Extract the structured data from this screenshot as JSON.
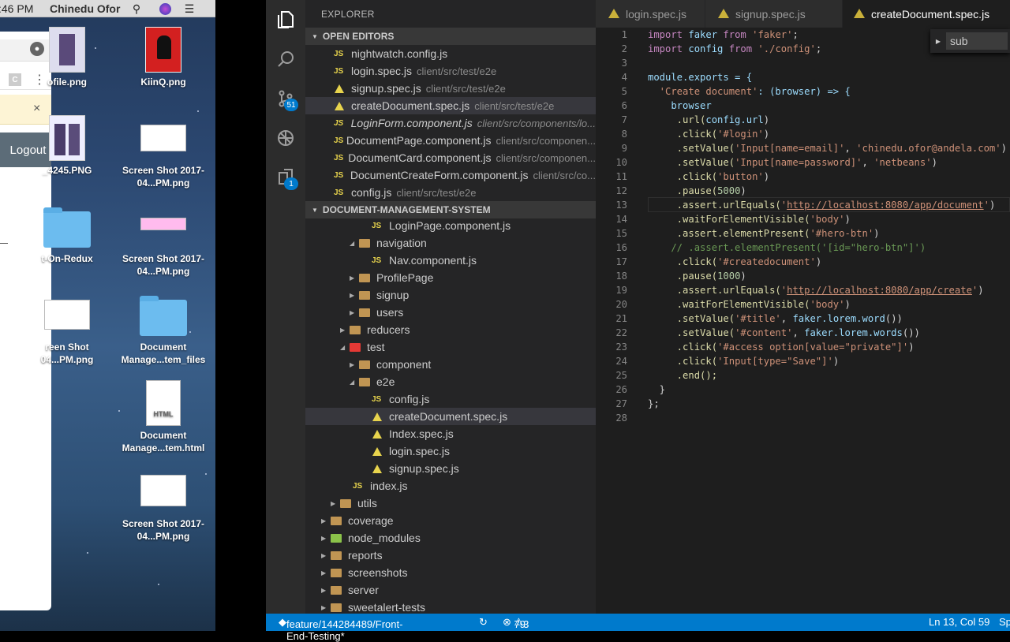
{
  "menubar": {
    "time": ":46 PM",
    "user": "Chinedu Ofor"
  },
  "browser": {
    "ext_letter": "C",
    "logout": "Logout"
  },
  "desktop_icons": [
    {
      "label": "ofile.png"
    },
    {
      "label": "KiinQ.png"
    },
    {
      "label": "_4245.PNG"
    },
    {
      "label": "Screen Shot 2017-04...PM.png"
    },
    {
      "label": "t-On-Redux"
    },
    {
      "label": "Screen Shot 2017-04...PM.png"
    },
    {
      "label": "reen Shot 04...PM.png"
    },
    {
      "label": "Document Manage...tem_files"
    },
    {
      "label": "Document Manage...tem.html"
    },
    {
      "label": "Screen Shot 2017-04...PM.png"
    }
  ],
  "activity": {
    "git_badge": "51",
    "ext_badge": "1"
  },
  "explorer": {
    "title": "EXPLORER",
    "open_editors_label": "OPEN EDITORS",
    "open_editors": [
      {
        "name": "nightwatch.config.js",
        "desc": ""
      },
      {
        "name": "login.spec.js",
        "desc": "client/src/test/e2e"
      },
      {
        "name": "signup.spec.js",
        "desc": "client/src/test/e2e"
      },
      {
        "name": "createDocument.spec.js",
        "desc": "client/src/test/e2e"
      },
      {
        "name": "LoginForm.component.js",
        "desc": "client/src/components/lo..."
      },
      {
        "name": "DocumentPage.component.js",
        "desc": "client/src/componen..."
      },
      {
        "name": "DocumentCard.component.js",
        "desc": "client/src/componen..."
      },
      {
        "name": "DocumentCreateForm.component.js",
        "desc": "client/src/co..."
      },
      {
        "name": "config.js",
        "desc": "client/src/test/e2e"
      }
    ],
    "project_label": "DOCUMENT-MANAGEMENT-SYSTEM",
    "tree": [
      "LoginPage.component.js",
      "navigation",
      "Nav.component.js",
      "ProfilePage",
      "signup",
      "users",
      "reducers",
      "test",
      "component",
      "e2e",
      "config.js",
      "createDocument.spec.js",
      "Index.spec.js",
      "login.spec.js",
      "signup.spec.js",
      "index.js",
      "utils",
      "coverage",
      "node_modules",
      "reports",
      "screenshots",
      "server",
      "sweetalert-tests"
    ]
  },
  "tabs": [
    "login.spec.js",
    "signup.spec.js",
    "createDocument.spec.js"
  ],
  "find": {
    "value": "sub"
  },
  "code_lines": [
    "1",
    "2",
    "3",
    "4",
    "5",
    "6",
    "7",
    "8",
    "9",
    "10",
    "11",
    "12",
    "13",
    "14",
    "15",
    "16",
    "17",
    "18",
    "19",
    "20",
    "21",
    "22",
    "23",
    "24",
    "25",
    "26",
    "27",
    "28"
  ],
  "code": {
    "l1a": "import",
    "l1b": " faker ",
    "l1c": "from",
    "l1d": " 'faker'",
    "l1e": ";",
    "l2a": "import",
    "l2b": " config ",
    "l2c": "from",
    "l2d": " './config'",
    "l2e": ";",
    "l4": "module.exports = {",
    "l5a": "  'Create document'",
    "l5b": ": (browser) => {",
    "l6": "    browser",
    "l7a": "     .url(",
    "l7b": "config.url",
    "l7c": ")",
    "l8a": "     .click(",
    "l8b": "'#login'",
    "l8c": ")",
    "l9a": "     .setValue(",
    "l9b": "'Input[name=email]'",
    "l9c": ", ",
    "l9d": "'chinedu.ofor@andela.com'",
    "l9e": ")",
    "l10a": "     .setValue(",
    "l10b": "'Input[name=password]'",
    "l10c": ", ",
    "l10d": "'netbeans'",
    "l10e": ")",
    "l11a": "     .click(",
    "l11b": "'button'",
    "l11c": ")",
    "l12a": "     .pause(",
    "l12b": "5000",
    "l12c": ")",
    "l13a": "     .assert.urlEquals(",
    "l13b": "'",
    "l13c": "http://localhost:8080/app/document",
    "l13d": "'",
    ")": ")",
    "l14a": "     .waitForElementVisible(",
    "l14b": "'body'",
    "l14c": ")",
    "l15a": "     .assert.elementPresent(",
    "l15b": "'#hero-btn'",
    "l15c": ")",
    "l16": "    // .assert.elementPresent('[id=\"hero-btn\"]')",
    "l17a": "     .click(",
    "l17b": "'#createdocument'",
    "l17c": ")",
    "l18a": "     .pause(",
    "l18b": "1000",
    "l18c": ")",
    "l19a": "     .assert.urlEquals(",
    "l19b": "'",
    "l19c": "http://localhost:8080/app/create",
    "l19d": "'",
    "l20a": "     .waitForElementVisible(",
    "l20b": "'body'",
    "l20c": ")",
    "l21a": "     .setValue(",
    "l21b": "'#title'",
    "l21c": ", ",
    "l21d": "faker.lorem.word",
    "l21e": "())",
    "l22a": "     .setValue(",
    "l22b": "'#content'",
    "l22c": ", ",
    "l22d": "faker.lorem.words",
    "l22e": "())",
    "l23a": "     .click(",
    "l23b": "'#access option[value=\"private\"]'",
    "l23c": ")",
    "l24a": "     .click(",
    "l24b": "'Input[type=\"Save\"]'",
    "l24c": ")",
    "l25": "     .end();",
    "l26": "  }",
    "l27": "};"
  },
  "status": {
    "branch": "feature/144284489/Front-End-Testing*",
    "errors": "79",
    "warnings": "3",
    "position": "Ln 13, Col 59",
    "extra": "Sp"
  }
}
